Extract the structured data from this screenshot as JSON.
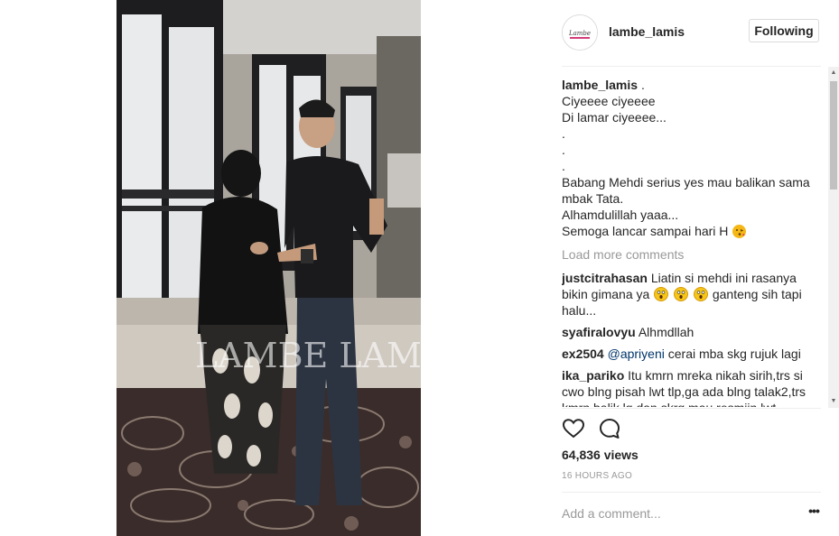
{
  "post": {
    "username": "lambe_lamis",
    "avatar_text": "Lambe Lamis",
    "follow_label": "Following",
    "watermark": "LAMBE LAMIS"
  },
  "caption": {
    "username": "lambe_lamis",
    "first_line_suffix": " .",
    "lines": [
      "Ciyeeee ciyeeee",
      "Di lamar ciyeeee...",
      ".",
      ".",
      ".",
      "Babang Mehdi serius yes mau balikan sama",
      "mbak Tata.",
      "Alhamdulillah yaaa...",
      "Semoga lancar sampai hari H"
    ],
    "last_line_emoji": "kissing-face-emoji"
  },
  "load_more_label": "Load more comments",
  "comments": [
    {
      "username": "justcitrahasan",
      "text_before": " Liatin si mehdi ini rasanya bikin gimana ya ",
      "emoji": [
        "face-screaming-emoji",
        "face-screaming-emoji",
        "face-screaming-emoji"
      ],
      "text_after": " ganteng sih tapi halu..."
    },
    {
      "username": "syafiralovyu",
      "text": " Alhmdllah"
    },
    {
      "username": "ex2504",
      "mention": "@apriyeni",
      "text": " cerai mba skg rujuk lagi"
    },
    {
      "username": "ika_pariko",
      "text": " Itu kmrn mreka nikah sirih,trs si cwo blng pisah lwt tlp,ga ada blng talak2,trs kmrn balik lg dan skrg mau resmiin lwt"
    }
  ],
  "actions": {
    "like_icon": "heart-outline-icon",
    "comment_icon": "comment-bubble-icon"
  },
  "views_label": "64,836 views",
  "timestamp": "16 HOURS AGO",
  "add_comment_placeholder": "Add a comment...",
  "more_options": "•••",
  "colors": {
    "text": "#262626",
    "muted": "#999999",
    "border": "#dbdbdb",
    "mention": "#003569"
  }
}
